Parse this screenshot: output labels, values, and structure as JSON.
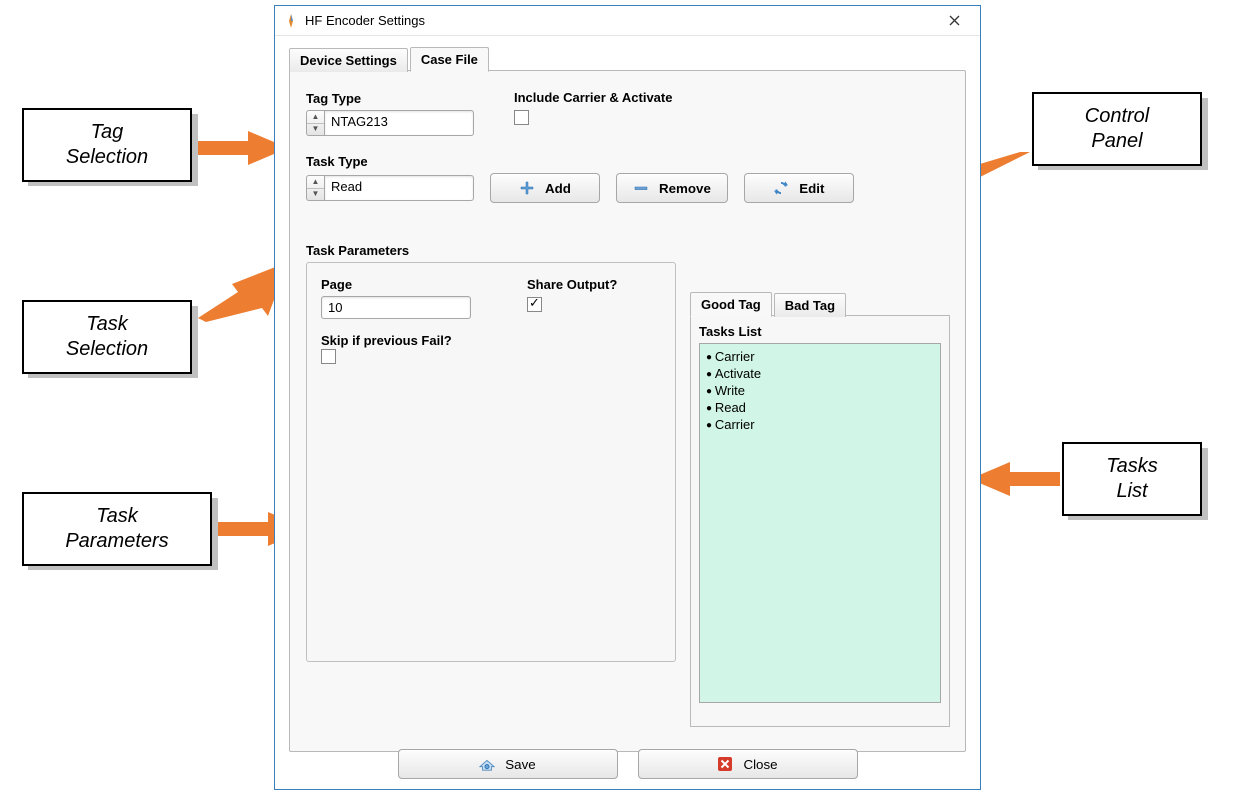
{
  "window": {
    "title": "HF Encoder Settings"
  },
  "outerTabs": {
    "deviceSettings": "Device Settings",
    "caseFile": "Case File"
  },
  "tagType": {
    "label": "Tag Type",
    "value": "NTAG213"
  },
  "includeCarrier": {
    "label": "Include Carrier & Activate",
    "checked": false
  },
  "taskType": {
    "label": "Task Type",
    "value": "Read"
  },
  "buttons": {
    "add": "Add",
    "remove": "Remove",
    "edit": "Edit"
  },
  "taskParams": {
    "title": "Task Parameters",
    "pageLabel": "Page",
    "pageValue": "10",
    "shareOutputLabel": "Share Output?",
    "shareOutputChecked": true,
    "skipIfFailLabel": "Skip if previous Fail?",
    "skipIfFailChecked": false
  },
  "innerTabs": {
    "good": "Good Tag",
    "bad": "Bad Tag"
  },
  "tasksList": {
    "label": "Tasks List",
    "items": [
      "Carrier",
      "Activate",
      "Write",
      "Read",
      "Carrier"
    ]
  },
  "bottom": {
    "save": "Save",
    "close": "Close"
  },
  "callouts": {
    "tagSelection": "Tag\nSelection",
    "taskSelection": "Task\nSelection",
    "taskParameters": "Task\nParameters",
    "controlPanel": "Control\nPanel",
    "tasksList": "Tasks\nList"
  },
  "colors": {
    "arrow": "#ED7D31",
    "listBg": "#d1f5e6"
  }
}
